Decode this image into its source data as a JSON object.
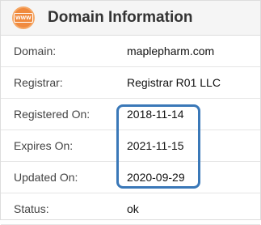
{
  "header": {
    "icon_text": "www",
    "title": "Domain Information"
  },
  "rows": [
    {
      "label": "Domain:",
      "value": "maplepharm.com"
    },
    {
      "label": "Registrar:",
      "value": "Registrar R01 LLC"
    },
    {
      "label": "Registered On:",
      "value": "2018-11-14"
    },
    {
      "label": "Expires On:",
      "value": "2021-11-15"
    },
    {
      "label": "Updated On:",
      "value": "2020-09-29"
    },
    {
      "label": "Status:",
      "value": "ok"
    }
  ],
  "colors": {
    "icon": "#f08a3e",
    "highlight": "#3a78b8"
  },
  "icons": [
    "www-icon"
  ]
}
